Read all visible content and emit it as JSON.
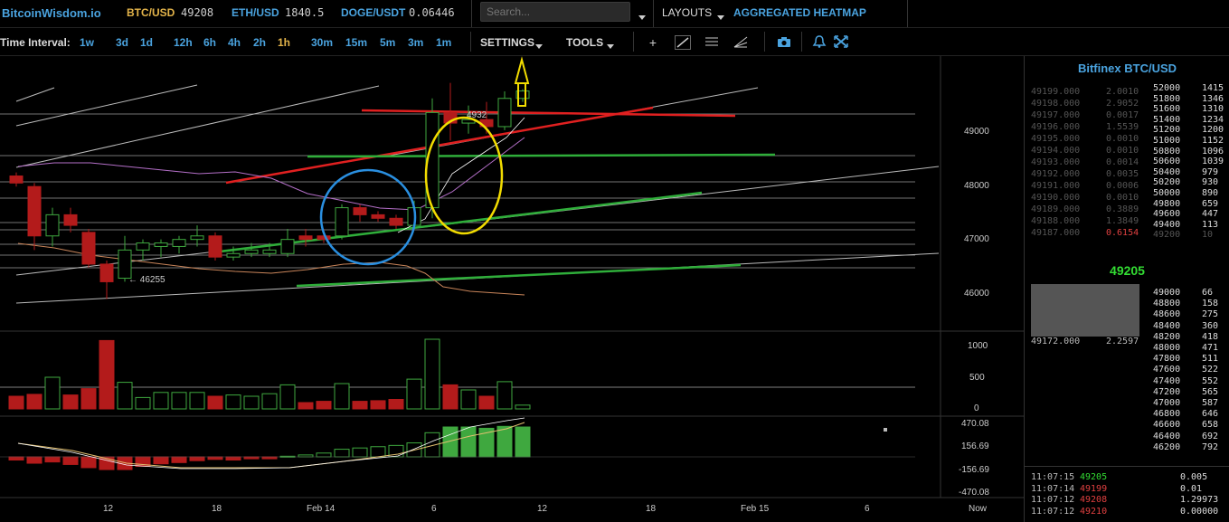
{
  "topbar": {
    "logo": "BitcoinWisdom.io",
    "pairs": [
      {
        "label": "BTC/USD",
        "price": "49208"
      },
      {
        "label": "ETH/USD",
        "price": "1840.5"
      },
      {
        "label": "DOGE/USDT",
        "price": "0.06446"
      }
    ],
    "search_placeholder": "Search...",
    "layouts": "LAYOUTS",
    "aggregated": "AGGREGATED HEATMAP"
  },
  "toolbar": {
    "time_interval_label": "Time Interval:",
    "intervals": [
      "1w",
      "3d",
      "1d",
      "12h",
      "6h",
      "4h",
      "2h",
      "1h",
      "30m",
      "15m",
      "5m",
      "3m",
      "1m"
    ],
    "active_interval": "1h",
    "settings": "SETTINGS",
    "tools": "TOOLS"
  },
  "chart": {
    "price_axis": [
      "49000",
      "48000",
      "47000",
      "46000"
    ],
    "volume_axis": [
      "1000",
      "500",
      "0"
    ],
    "macd_axis": [
      "470.08",
      "156.69",
      "-156.69",
      "-470.08"
    ],
    "time_axis": [
      "12",
      "18",
      "Feb 14",
      "6",
      "12",
      "18",
      "Feb 15",
      "6",
      "Now"
    ],
    "low_label": "← 46255",
    "high_label": "4932"
  },
  "chart_data": {
    "type": "candlestick",
    "title": "",
    "ylim": [
      45800,
      49700
    ],
    "candles": [
      {
        "o": 48000,
        "c": 47900,
        "h": 48050,
        "l": 47850,
        "color": "red"
      },
      {
        "o": 47850,
        "c": 47150,
        "h": 47900,
        "l": 46950,
        "color": "red"
      },
      {
        "o": 47150,
        "c": 47450,
        "h": 47550,
        "l": 47000,
        "color": "green"
      },
      {
        "o": 47450,
        "c": 47300,
        "h": 47550,
        "l": 47200,
        "color": "red"
      },
      {
        "o": 47200,
        "c": 46750,
        "h": 47250,
        "l": 46700,
        "color": "red"
      },
      {
        "o": 46750,
        "c": 46500,
        "h": 46800,
        "l": 46255,
        "color": "red"
      },
      {
        "o": 46550,
        "c": 46950,
        "h": 47150,
        "l": 46500,
        "color": "green"
      },
      {
        "o": 46950,
        "c": 47050,
        "h": 47100,
        "l": 46800,
        "color": "green"
      },
      {
        "o": 47050,
        "c": 47000,
        "h": 47100,
        "l": 46850,
        "color": "green"
      },
      {
        "o": 47000,
        "c": 47100,
        "h": 47150,
        "l": 46900,
        "color": "green"
      },
      {
        "o": 47100,
        "c": 47150,
        "h": 47300,
        "l": 47000,
        "color": "green"
      },
      {
        "o": 47150,
        "c": 46850,
        "h": 47200,
        "l": 46800,
        "color": "red"
      },
      {
        "o": 46850,
        "c": 46900,
        "h": 47000,
        "l": 46800,
        "color": "green"
      },
      {
        "o": 46900,
        "c": 46950,
        "h": 47050,
        "l": 46850,
        "color": "green"
      },
      {
        "o": 46950,
        "c": 46900,
        "h": 47050,
        "l": 46850,
        "color": "green"
      },
      {
        "o": 46900,
        "c": 47100,
        "h": 47250,
        "l": 46850,
        "color": "green"
      },
      {
        "o": 47100,
        "c": 47150,
        "h": 47250,
        "l": 47000,
        "color": "red"
      },
      {
        "o": 47150,
        "c": 47100,
        "h": 47250,
        "l": 47050,
        "color": "red"
      },
      {
        "o": 47150,
        "c": 47550,
        "h": 47600,
        "l": 47100,
        "color": "green"
      },
      {
        "o": 47550,
        "c": 47450,
        "h": 47600,
        "l": 47350,
        "color": "red"
      },
      {
        "o": 47450,
        "c": 47400,
        "h": 47500,
        "l": 47350,
        "color": "red"
      },
      {
        "o": 47400,
        "c": 47300,
        "h": 47450,
        "l": 47250,
        "color": "red"
      },
      {
        "o": 47300,
        "c": 47550,
        "h": 47650,
        "l": 47250,
        "color": "green"
      },
      {
        "o": 47550,
        "c": 48900,
        "h": 49100,
        "l": 47400,
        "color": "green"
      },
      {
        "o": 48900,
        "c": 48750,
        "h": 49320,
        "l": 48500,
        "color": "red"
      },
      {
        "o": 48750,
        "c": 48800,
        "h": 49000,
        "l": 48600,
        "color": "green"
      },
      {
        "o": 48800,
        "c": 48700,
        "h": 49050,
        "l": 48600,
        "color": "red"
      },
      {
        "o": 48700,
        "c": 49100,
        "h": 49200,
        "l": 48650,
        "color": "green"
      },
      {
        "o": 49100,
        "c": 49205,
        "h": 49230,
        "l": 49050,
        "color": "green"
      }
    ],
    "volume": [
      200,
      230,
      500,
      220,
      320,
      1080,
      420,
      180,
      260,
      260,
      260,
      200,
      220,
      200,
      240,
      380,
      100,
      120,
      400,
      120,
      130,
      150,
      470,
      1100,
      380,
      300,
      200,
      430,
      60
    ],
    "macd": [
      -50,
      -100,
      -80,
      -120,
      -170,
      -200,
      -200,
      -150,
      -110,
      -90,
      -60,
      -40,
      -50,
      -30,
      -30,
      10,
      30,
      60,
      120,
      140,
      160,
      180,
      220,
      380,
      470,
      470,
      450,
      480,
      470
    ]
  },
  "orderbook": {
    "title": "Bitfinex BTC/USD",
    "asks_left": [
      [
        "49199.000",
        "2.0010"
      ],
      [
        "49198.000",
        "2.9052"
      ],
      [
        "49197.000",
        "0.0017"
      ],
      [
        "49196.000",
        "1.5539"
      ],
      [
        "49195.000",
        "0.0010"
      ],
      [
        "49194.000",
        "0.0010"
      ],
      [
        "49193.000",
        "0.0014"
      ],
      [
        "49192.000",
        "0.0035"
      ],
      [
        "49191.000",
        "0.0006"
      ],
      [
        "49190.000",
        "0.0010"
      ],
      [
        "49189.000",
        "0.3889"
      ],
      [
        "49188.000",
        "1.3849"
      ],
      [
        "49187.000",
        "0.6154"
      ]
    ],
    "asks_right": [
      [
        "52000",
        "1415"
      ],
      [
        "51800",
        "1346"
      ],
      [
        "51600",
        "1310"
      ],
      [
        "51400",
        "1234"
      ],
      [
        "51200",
        "1200"
      ],
      [
        "51000",
        "1152"
      ],
      [
        "50800",
        "1096"
      ],
      [
        "50600",
        "1039"
      ],
      [
        "50400",
        "979"
      ],
      [
        "50200",
        "930"
      ],
      [
        "50000",
        "890"
      ],
      [
        "49800",
        "659"
      ],
      [
        "49600",
        "447"
      ],
      [
        "49400",
        "113"
      ],
      [
        "49200",
        "10"
      ]
    ],
    "last_price": "49205",
    "bid_left_last": [
      "49172.000",
      "2.2597"
    ],
    "bids_right": [
      [
        "49000",
        "66"
      ],
      [
        "48800",
        "158"
      ],
      [
        "48600",
        "275"
      ],
      [
        "48400",
        "360"
      ],
      [
        "48200",
        "418"
      ],
      [
        "48000",
        "471"
      ],
      [
        "47800",
        "511"
      ],
      [
        "47600",
        "522"
      ],
      [
        "47400",
        "552"
      ],
      [
        "47200",
        "565"
      ],
      [
        "47000",
        "587"
      ],
      [
        "46800",
        "646"
      ],
      [
        "46600",
        "658"
      ],
      [
        "46400",
        "692"
      ],
      [
        "46200",
        "792"
      ]
    ],
    "trades": [
      {
        "time": "11:07:15",
        "price": "49205",
        "amount": "0.005",
        "side": "buy"
      },
      {
        "time": "11:07:14",
        "price": "49199",
        "amount": "0.01",
        "side": "sell"
      },
      {
        "time": "11:07:12",
        "price": "49208",
        "amount": "1.29973",
        "side": "sell"
      },
      {
        "time": "11:07:12",
        "price": "49210",
        "amount": "0.00000",
        "side": "sell"
      }
    ]
  },
  "colors": {
    "accent": "#4aa3df",
    "highlight": "#e2b34a",
    "up": "#3fa83f",
    "down": "#b31b1b",
    "last": "#33dd33"
  }
}
